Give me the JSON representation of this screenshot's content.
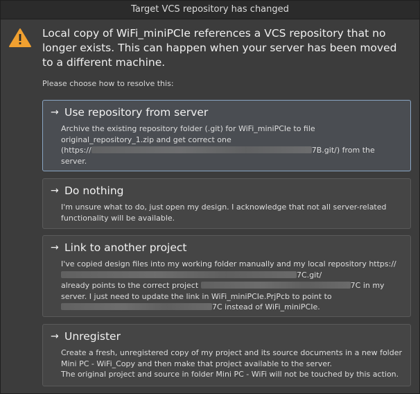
{
  "window": {
    "title": "Target VCS repository has changed"
  },
  "header": {
    "icon": "warning-icon",
    "message": "Local copy of WiFi_miniPCIe references a VCS repository that no longer exists. This can happen when your server has been moved to a different machine."
  },
  "prompt": "Please choose how to resolve this:",
  "options": [
    {
      "title": "Use repository from server",
      "desc_a": "Archive the existing repository folder (.git) for WiFi_miniPCIe to file original_repository_1.zip and get correct one",
      "desc_b": "(https://",
      "desc_c": "7B.git/) from the server."
    },
    {
      "title": "Do nothing",
      "desc": "I'm unsure what to do, just open my design. I acknowledge that not all server-related functionality will be available."
    },
    {
      "title": "Link to another project",
      "desc_a": "I've copied design files into my working folder manually and my local repository https://",
      "desc_b": "7C.git/",
      "desc_c": "already points to the correct project",
      "desc_d": "7C in my server. I just need to update the link in WiFi_miniPCIe.PrjPcb to point to",
      "desc_e": "7C instead of WiFi_miniPCIe."
    },
    {
      "title": "Unregister",
      "desc_a": "Create a fresh, unregistered copy of my project and its source documents in a new folder Mini PC - WiFi_Copy and then make that project available to the server.",
      "desc_b": "The original project and source in folder Mini PC - WiFi will not be touched by this action."
    }
  ],
  "colors": {
    "selected_border": "#8aa6c4",
    "warning": "#f0a030"
  }
}
